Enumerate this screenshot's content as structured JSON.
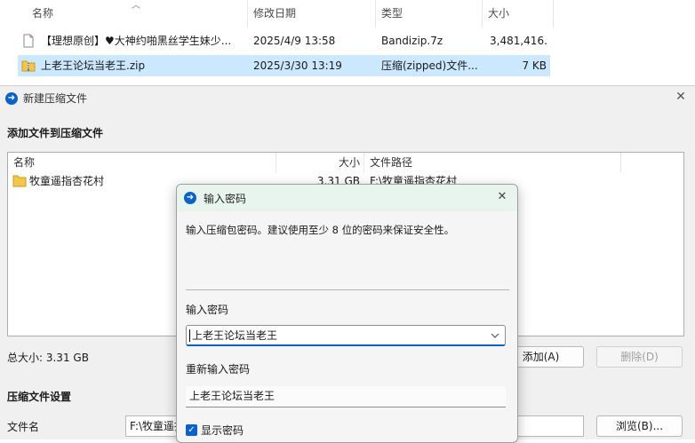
{
  "explorer": {
    "columns": {
      "name": "名称",
      "modified": "修改日期",
      "type": "类型",
      "size": "大小"
    },
    "files": [
      {
        "name": "【理想原创】♥大神约啪黑丝学生妹少...",
        "date": "2025/4/9 13:58",
        "type": "Bandizip.7z",
        "size": "3,481,416..."
      },
      {
        "name": "上老王论坛当老王.zip",
        "date": "2025/3/30 13:19",
        "type": "压缩(zipped)文件...",
        "size": "7 KB"
      }
    ]
  },
  "main_window": {
    "title": "新建压缩文件",
    "add_files_section": "添加文件到压缩文件",
    "list_columns": {
      "name": "名称",
      "size": "大小",
      "path": "文件路径"
    },
    "entries": [
      {
        "name": "牧童遥指杏花村",
        "size": "3.31 GB",
        "path": "F:\\牧童遥指杏花村"
      }
    ],
    "total_size": "总大小: 3.31 GB",
    "add_button": "添加(A)",
    "delete_button": "删除(D)",
    "settings_section": "压缩文件设置",
    "filename_label": "文件名",
    "filename_value": "F:\\牧童遥指",
    "browse_button": "浏览(B)..."
  },
  "password_dialog": {
    "title": "输入密码",
    "description": "输入压缩包密码。建议使用至少 8 位的密码来保证安全性。",
    "password_label": "输入密码",
    "password_value": "上老王论坛当老王",
    "reenter_label": "重新输入密码",
    "reenter_value": "上老王论坛当老王",
    "show_password_label": "显示密码"
  },
  "colors": {
    "accent": "#0b63c9",
    "selection": "#cce8ff",
    "dialog_titlebar": "#e8f5ee",
    "folder": "#f3c64b"
  }
}
